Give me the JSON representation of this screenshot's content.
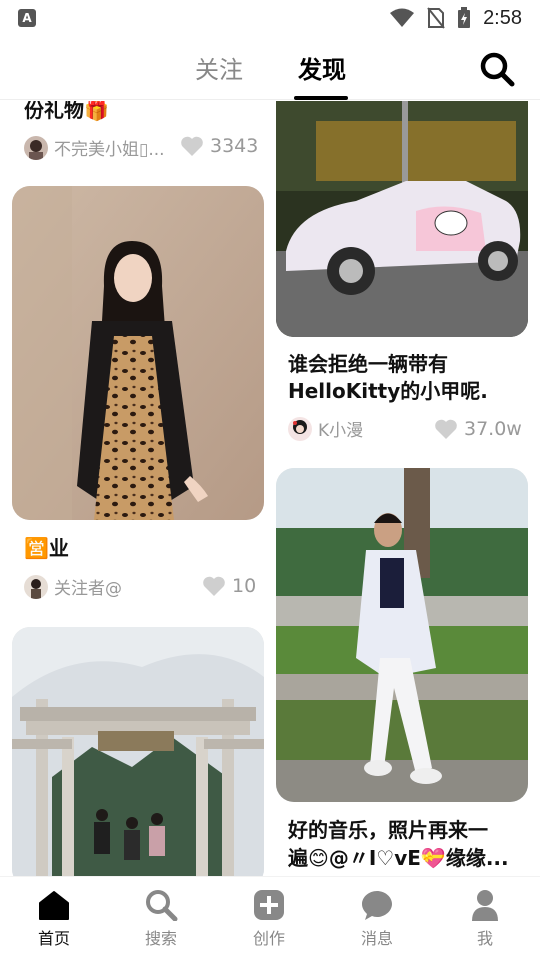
{
  "status_bar": {
    "app_icon_letter": "A",
    "time": "2:58"
  },
  "top_tabs": [
    {
      "label": "关注",
      "active": false
    },
    {
      "label": "发现",
      "active": true
    }
  ],
  "feed": {
    "left": [
      {
        "title": "份礼物🎁",
        "author": "不完美小姐▯...",
        "likes": "3343"
      },
      {
        "title": "🈺业",
        "author": "关注者@",
        "likes": "10"
      },
      {
        "title": "",
        "author": "",
        "likes": ""
      }
    ],
    "right": [
      {
        "title_line1": "谁会拒绝一辆带有",
        "title_line2": "HelloKitty的小甲呢.",
        "author": "K小漫",
        "likes": "37.0w"
      },
      {
        "title_line1": "好的音乐，照片再来一",
        "title_line2": "遍😊@〃I♡vE💝缘缘..."
      }
    ]
  },
  "bottom_nav": [
    {
      "label": "首页",
      "icon": "home-icon",
      "active": true
    },
    {
      "label": "搜索",
      "icon": "search-icon",
      "active": false
    },
    {
      "label": "创作",
      "icon": "plus-square-icon",
      "active": false
    },
    {
      "label": "消息",
      "icon": "chat-bubble-icon",
      "active": false
    },
    {
      "label": "我",
      "icon": "user-icon",
      "active": false
    }
  ],
  "colors": {
    "accent": "#000000",
    "inactive": "#888888",
    "meta": "#999999"
  }
}
